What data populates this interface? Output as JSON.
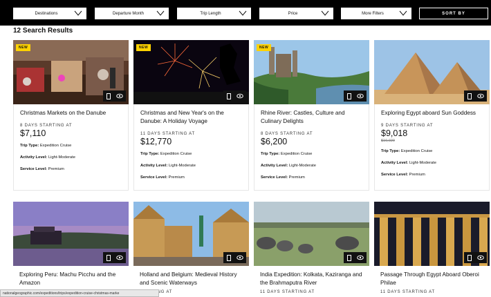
{
  "filters": [
    {
      "label": "Destinations"
    },
    {
      "label": "Departure Month"
    },
    {
      "label": "Trip Length"
    },
    {
      "label": "Price"
    },
    {
      "label": "More Filters"
    }
  ],
  "sort_label": "SORT BY",
  "results_count": "12 Search Results",
  "new_badge": "NEW",
  "labels": {
    "trip_type": "Trip Type:",
    "activity": "Activity Level:",
    "service": "Service Level:"
  },
  "cards": [
    {
      "title": "Christmas Markets on the Danube",
      "days": "8 DAYS STARTING AT",
      "price": "$7,110",
      "strike": "",
      "trip_type": "Expedition Cruise",
      "activity": "Light-Moderate",
      "service": "Premium",
      "is_new": true
    },
    {
      "title": "Christmas and New Year's on the Danube: A Holiday Voyage",
      "days": "11 DAYS STARTING AT",
      "price": "$12,770",
      "strike": "",
      "trip_type": "Expedition Cruise",
      "activity": "Light-Moderate",
      "service": "Premium",
      "is_new": true
    },
    {
      "title": "Rhine River: Castles, Culture and Culinary Delights",
      "days": "8 DAYS STARTING AT",
      "price": "$6,200",
      "strike": "",
      "trip_type": "Expedition Cruise",
      "activity": "Light-Moderate",
      "service": "Premium",
      "is_new": true
    },
    {
      "title": "Exploring Egypt aboard Sun Goddess",
      "days": "9 DAYS STARTING AT",
      "price": "$9,018",
      "strike": "$10,020",
      "trip_type": "Expedition Cruise",
      "activity": "Light-Moderate",
      "service": "Premium",
      "is_new": false
    },
    {
      "title": "Exploring Peru: Machu Picchu and the Amazon",
      "days": "",
      "price": "",
      "strike": "",
      "trip_type": "",
      "activity": "",
      "service": "",
      "is_new": false
    },
    {
      "title": "Holland and Belgium: Medieval History and Scenic Waterways",
      "days": "STARTING AT",
      "price": "",
      "strike": "",
      "trip_type": "",
      "activity": "",
      "service": "",
      "is_new": false
    },
    {
      "title": "India Expedition: Kolkata, Kaziranga and the Brahmaputra River",
      "days": "11 DAYS STARTING AT",
      "price": "",
      "strike": "",
      "trip_type": "",
      "activity": "",
      "service": "",
      "is_new": false
    },
    {
      "title": "Passage Through Egypt Aboard Oberoi Philae",
      "days": "11 DAYS STARTING AT",
      "price": "",
      "strike": "",
      "trip_type": "",
      "activity": "",
      "service": "",
      "is_new": false
    }
  ],
  "status_url": "nationalgeographic.com/expeditions/trips/expedition-cruise-christmas-marke",
  "icons": {
    "card_icon_1": "phone-icon",
    "card_icon_2": "eye-icon",
    "filter_caret": "chevron-down-icon"
  }
}
